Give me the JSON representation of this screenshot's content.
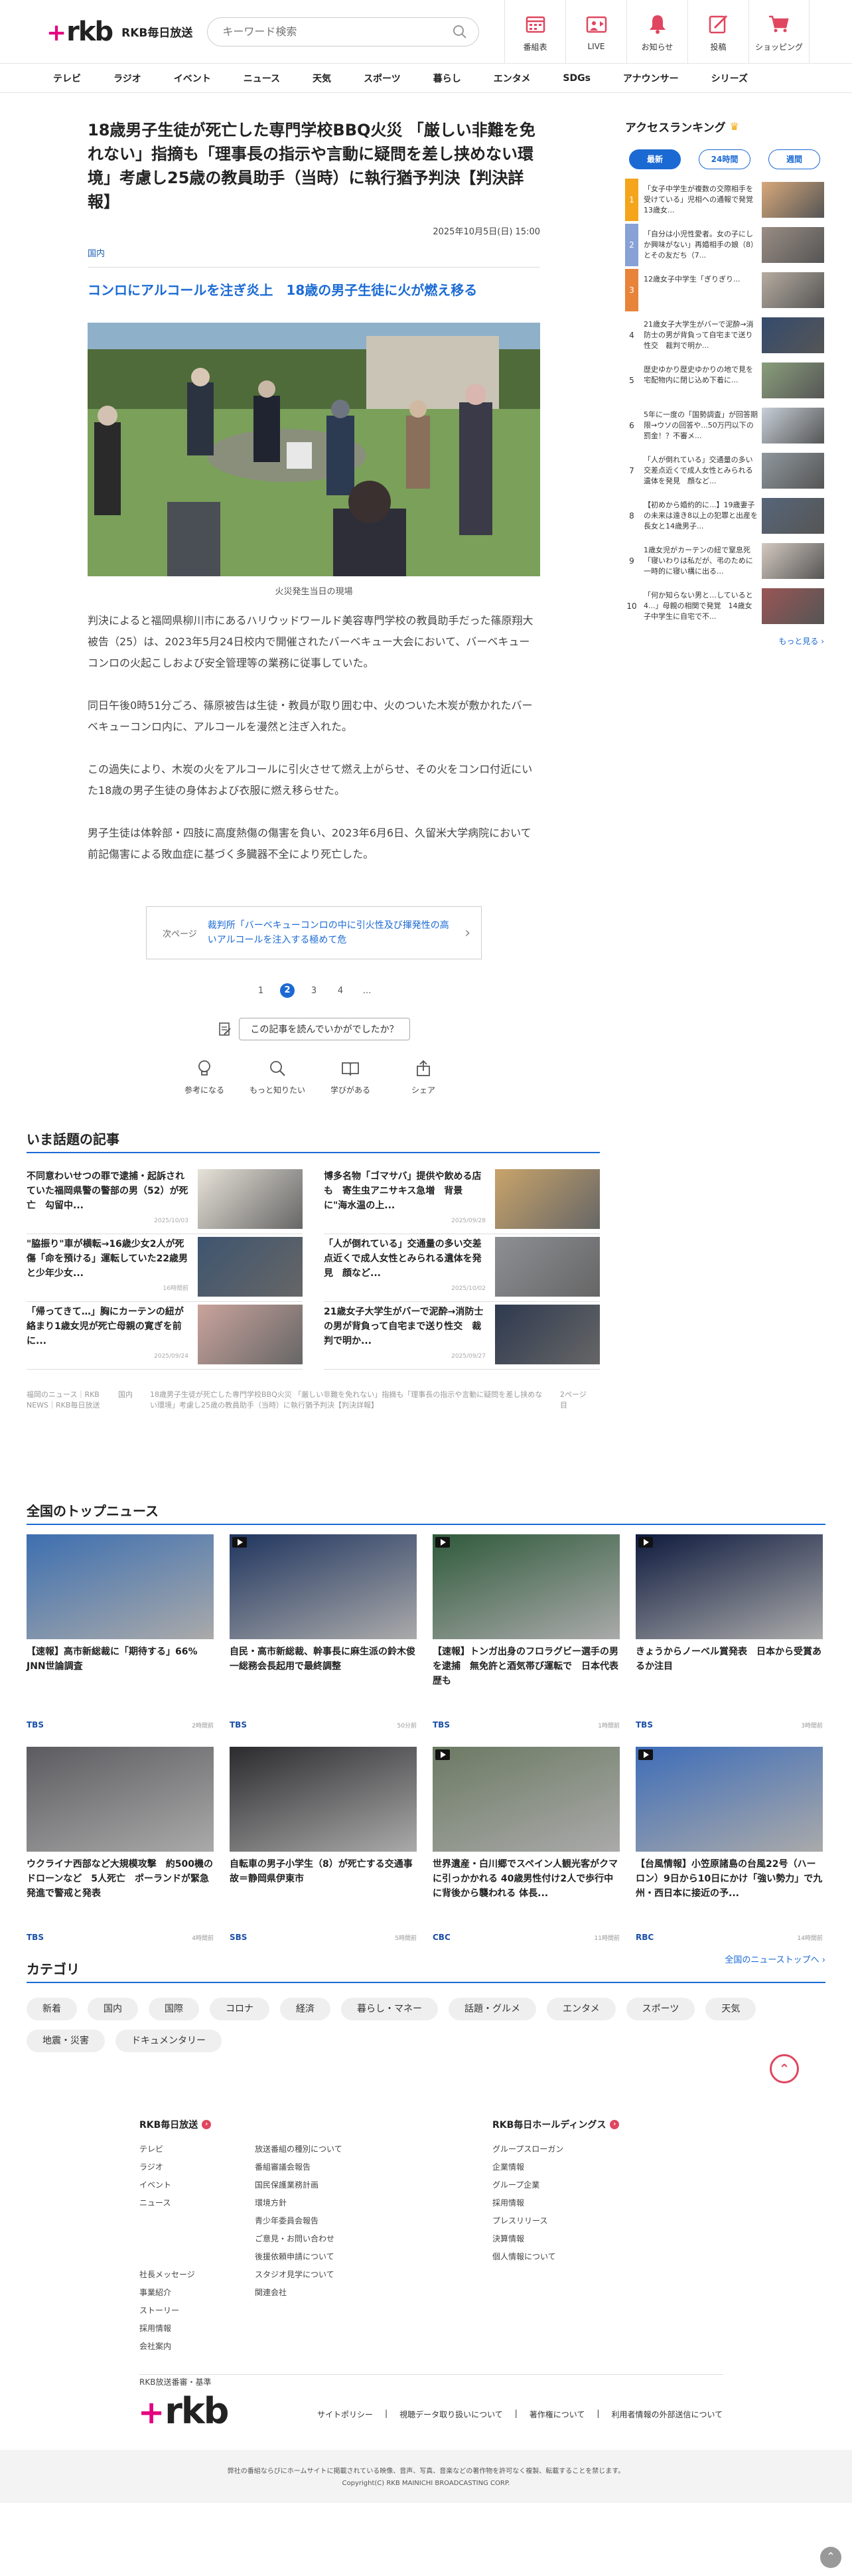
{
  "header": {
    "logo_mark": "rkb",
    "logo_text": "RKB毎日放送",
    "search_placeholder": "キーワード検索",
    "icons": [
      {
        "label": "番組表",
        "icon": "tv-guide-icon"
      },
      {
        "label": "LIVE",
        "icon": "live-icon"
      },
      {
        "label": "お知らせ",
        "icon": "bell-icon"
      },
      {
        "label": "投稿",
        "icon": "post-icon"
      },
      {
        "label": "ショッピング",
        "icon": "cart-icon"
      }
    ]
  },
  "nav": [
    "テレビ",
    "ラジオ",
    "イベント",
    "ニュース",
    "天気",
    "スポーツ",
    "暮らし",
    "エンタメ",
    "SDGs",
    "アナウンサー",
    "シリーズ"
  ],
  "article": {
    "title": "18歳男子生徒が死亡した専門学校BBQ火災 「厳しい非難を免れない」指摘も「理事長の指示や言動に疑問を差し挟めない環境」考慮し25歳の教員助手（当時）に執行猶予判決【判決詳報】",
    "date": "2025年10月5日(日) 15:00",
    "category": "国内",
    "subhead": "コンロにアルコールを注ぎ炎上　18歳の男子生徒に火が燃え移る",
    "caption": "火災発生当日の現場",
    "paragraphs": [
      "判決によると福岡県柳川市にあるハリウッドワールド美容専門学校の教員助手だった篠原翔大被告（25）は、2023年5月24日校内で開催されたバーベキュー大会において、バーベキューコンロの火起こしおよび安全管理等の業務に従事していた。",
      "同日午後0時51分ごろ、篠原被告は生徒・教員が取り囲む中、火のついた木炭が敷かれたバーベキューコンロ内に、アルコールを漫然と注ぎ入れた。",
      "この過失により、木炭の火をアルコールに引火させて燃え上がらせ、その火をコンロ付近にいた18歳の男子生徒の身体および衣服に燃え移らせた。",
      "男子生徒は体幹部・四肢に高度熱傷の傷害を負い、2023年6月6日、久留米大学病院において前記傷害による敗血症に基づく多臓器不全により死亡した。"
    ],
    "next_label": "次ページ",
    "next_text": "裁判所「バーベキューコンロの中に引火性及び揮発性の高いアルコールを注入する極めて危",
    "pager": [
      "1",
      "2",
      "3",
      "4",
      "…"
    ],
    "question": "この記事を読んでいかがでしたか？",
    "reactions": [
      {
        "label": "参考になる",
        "icon": "lightbulb-icon"
      },
      {
        "label": "もっと知りたい",
        "icon": "magnifier-icon"
      },
      {
        "label": "学びがある",
        "icon": "book-icon"
      },
      {
        "label": "シェア",
        "icon": "share-icon"
      }
    ]
  },
  "ranking": {
    "title": "アクセスランキング",
    "tabs": [
      "最新",
      "24時間",
      "週間"
    ],
    "items": [
      {
        "rank": "1",
        "text": "「女子中学生が複数の交際相手を受けている」児相への通報で発覚　13歳女..."
      },
      {
        "rank": "2",
        "text": "「自分は小児性愛者。女の子にしか興味がない」再婚相手の娘（8）とその友だち（7..."
      },
      {
        "rank": "3",
        "text": "12歳女子中学生「ぎりぎり..."
      },
      {
        "rank": "4",
        "text": "21歳女子大学生がバーで泥酔→消防士の男が背負って自宅まで送り性交　裁判で明か..."
      },
      {
        "rank": "5",
        "text": "歴史ゆかり歴史ゆかりの地で見を宅配物内に閉じ込め下着に..."
      },
      {
        "rank": "6",
        "text": "5年に一度の「国勢調査」が回答期限→ウソの回答や...50万円以下の罰金！？不審メ..."
      },
      {
        "rank": "7",
        "text": "「人が倒れている」交通量の多い交差点近くで成人女性とみられる遺体を発見　顔など..."
      },
      {
        "rank": "8",
        "text": "【初めから婚約的に...】19歳妻子の未来は遠き8以上の犯罪と出産を　長女と14歳男子..."
      },
      {
        "rank": "9",
        "text": "1歳女児がカーテンの紐で窒息死「寝いわりは私だが、弔のために一時的に寝い構に出る..."
      },
      {
        "rank": "10",
        "text": "「何か知らない男と…していると4...」母親の相関で発覚　14歳女子中学生に自宅で不..."
      }
    ],
    "more": "もっと見る ›"
  },
  "hot": {
    "title": "いま話題の記事",
    "items": [
      {
        "text": "不同意わいせつの罪で逮捕・起訴されていた福岡県警の警部の男（52）が死亡　勾留中...",
        "date": "2025/10/03"
      },
      {
        "text": "博多名物「ゴマサバ」提供や飲める店も　寄生虫アニサキス急増　背景に\"海水温の上...",
        "date": "2025/09/28"
      },
      {
        "text": "\"脇振り\"車が横転→16歳少女2人が死傷「命を預ける」運転していた22歳男と少年少女...",
        "date": "16時間前"
      },
      {
        "text": "「人が倒れている」交通量の多い交差点近くで成人女性とみられる遺体を発見　顔など...",
        "date": "2025/10/02"
      },
      {
        "text": "「帰ってきて…」胸にカーテンの紐が絡まり1歳女児が死亡母親の寛ぎを前に...",
        "date": "2025/09/24"
      },
      {
        "text": "21歳女子大学生がバーで泥酔→消防士の男が背負って自宅まで送り性交　裁判で明か...",
        "date": "2025/09/27"
      }
    ],
    "crumbs": [
      "福岡のニュース｜RKB NEWS｜RKB毎日放送",
      "国内",
      "18歳男子生徒が死亡した専門学校BBQ火災 「厳しい非難を免れない」指摘も「理事長の指示や言動に疑問を差し挟めない環境」考慮し25歳の教員助手（当時）に執行猶予判決【判決詳報】",
      "2ページ目"
    ]
  },
  "national": {
    "title": "全国のトップニュース",
    "items": [
      {
        "title": "【速報】高市新総裁に「期待する」66%　JNN世論調査",
        "source": "TBS",
        "time": "2時間前"
      },
      {
        "title": "自民・高市新総裁、幹事長に麻生派の鈴木俊一総務会長起用で最終調整",
        "source": "TBS",
        "time": "50分前"
      },
      {
        "title": "【速報】トンガ出身のフロラグビー選手の男を逮捕　無免許と酒気帯び運転で　日本代表歴も",
        "source": "TBS",
        "time": "1時間前"
      },
      {
        "title": "きょうからノーベル賞発表　日本から受賞あるか注目",
        "source": "TBS",
        "time": "3時間前"
      },
      {
        "title": "ウクライナ西部など大規模攻撃　約500機のドローンなど　5人死亡　ポーランドが緊急発進で警戒と発表",
        "source": "TBS",
        "time": "4時間前"
      },
      {
        "title": "自転車の男子小学生（8）が死亡する交通事故＝静岡県伊東市",
        "source": "SBS",
        "time": "5時間前"
      },
      {
        "title": "世界遺産・白川郷でスペイン人観光客がクマに引っかかれる 40歳男性付け2人で歩行中に背後から襲われる 体長...",
        "source": "CBC",
        "time": "11時間前"
      },
      {
        "title": "【台風情報】小笠原諸島の台風22号（ハーロン）9日から10日にかけ「強い勢力」で九州・西日本に接近の予...",
        "source": "RBC",
        "time": "14時間前"
      }
    ],
    "more": "全国のニューストップへ ›"
  },
  "categories": {
    "title": "カテゴリ",
    "items": [
      "新着",
      "国内",
      "国際",
      "コロナ",
      "経済",
      "暮らし・マネー",
      "話題・グルメ",
      "エンタメ",
      "スポーツ",
      "天気",
      "地震・災害",
      "ドキュメンタリー"
    ]
  },
  "footer": {
    "col1_title": "RKB毎日放送",
    "col1_a": [
      "テレビ",
      "ラジオ",
      "イベント",
      "ニュース",
      "",
      "",
      "",
      "社長メッセージ",
      "事業紹介",
      "ストーリー",
      "採用情報",
      "会社案内",
      "",
      "RKB放送番審・基準"
    ],
    "col1_b": [
      "放送番組の種別について",
      "番組審議会報告",
      "国民保護業務計画",
      "環境方針",
      "青少年委員会報告",
      "ご意見・お問い合わせ",
      "後援依頼申請について",
      "スタジオ見学について",
      "関連会社"
    ],
    "col2_title": "RKB毎日ホールディングス",
    "col2": [
      "グループスローガン",
      "企業情報",
      "グループ企業",
      "採用情報",
      "プレスリリース",
      "決算情報",
      "個人情報について"
    ],
    "bottom_links": [
      "サイトポリシー",
      "視聴データ取り扱いについて",
      "著作権について",
      "利用者情報の外部送信について"
    ],
    "copyright1": "弊社の番組ならびにホームサイトに掲載されている映像、音声、写真、音楽などの著作物を許可なく複製、転載することを禁じます。",
    "copyright2": "Copyright(C) RKB MAINICHI BROADCASTING CORP."
  },
  "colors": {
    "accent": "#1b6ad4",
    "brand_pink": "#e4007f",
    "totop": "#e0465f"
  }
}
